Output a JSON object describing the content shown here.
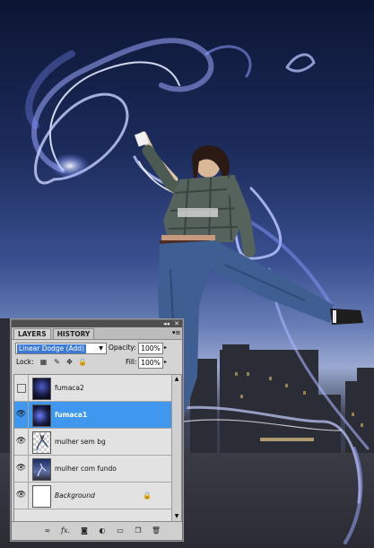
{
  "panel": {
    "tabs": [
      {
        "label": "LAYERS",
        "active": true
      },
      {
        "label": "HISTORY",
        "active": false
      }
    ],
    "blend_mode": "Linear Dodge (Add)",
    "opacity_label": "Opacity:",
    "opacity_value": "100%",
    "lock_label": "Lock:",
    "fill_label": "Fill:",
    "fill_value": "100%"
  },
  "layers": [
    {
      "name": "fumaca2",
      "visible": false,
      "selected": false,
      "thumb": "dark-blue-smoke"
    },
    {
      "name": "fumaca1",
      "visible": true,
      "selected": true,
      "thumb": "dark-blue-smoke"
    },
    {
      "name": "mulher sem bg",
      "visible": true,
      "selected": false,
      "thumb": "transparent-figure"
    },
    {
      "name": "mulher com fundo",
      "visible": true,
      "selected": false,
      "thumb": "photo"
    },
    {
      "name": "Background",
      "visible": true,
      "selected": false,
      "thumb": "white",
      "locked": true
    }
  ],
  "icons": {
    "panel_collapse": "double-arrow-icon",
    "panel_close": "close-icon",
    "panel_menu": "panel-menu-icon",
    "lock": [
      "lock-transparent-icon",
      "lock-image-icon",
      "lock-position-icon",
      "lock-all-icon"
    ],
    "bottom": [
      "link-layers-icon",
      "layer-style-icon",
      "layer-mask-icon",
      "adjustment-layer-icon",
      "group-folder-icon",
      "new-layer-icon",
      "trash-icon"
    ]
  },
  "colors": {
    "selected_row": "#3f98ee",
    "blend_highlight": "#3b7ad8",
    "panel_bg": "#d4d4d4"
  }
}
